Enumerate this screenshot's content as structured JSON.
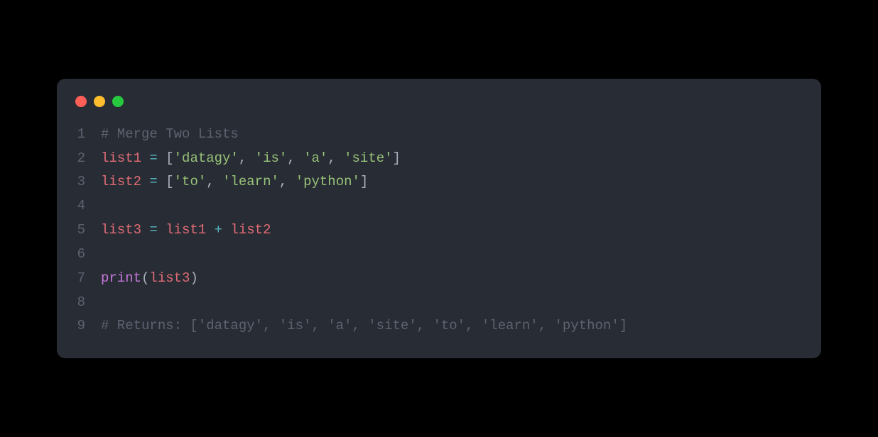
{
  "window": {
    "traffic_lights": [
      "red",
      "yellow",
      "green"
    ]
  },
  "code": {
    "lines": [
      {
        "n": "1",
        "tokens": [
          {
            "t": "# Merge Two Lists",
            "c": "c-comment"
          }
        ]
      },
      {
        "n": "2",
        "tokens": [
          {
            "t": "list1",
            "c": "c-var"
          },
          {
            "t": " ",
            "c": "c-plain"
          },
          {
            "t": "=",
            "c": "c-op"
          },
          {
            "t": " ",
            "c": "c-plain"
          },
          {
            "t": "[",
            "c": "c-punc"
          },
          {
            "t": "'datagy'",
            "c": "c-str"
          },
          {
            "t": ", ",
            "c": "c-punc"
          },
          {
            "t": "'is'",
            "c": "c-str"
          },
          {
            "t": ", ",
            "c": "c-punc"
          },
          {
            "t": "'a'",
            "c": "c-str"
          },
          {
            "t": ", ",
            "c": "c-punc"
          },
          {
            "t": "'site'",
            "c": "c-str"
          },
          {
            "t": "]",
            "c": "c-punc"
          }
        ]
      },
      {
        "n": "3",
        "tokens": [
          {
            "t": "list2",
            "c": "c-var"
          },
          {
            "t": " ",
            "c": "c-plain"
          },
          {
            "t": "=",
            "c": "c-op"
          },
          {
            "t": " ",
            "c": "c-plain"
          },
          {
            "t": "[",
            "c": "c-punc"
          },
          {
            "t": "'to'",
            "c": "c-str"
          },
          {
            "t": ", ",
            "c": "c-punc"
          },
          {
            "t": "'learn'",
            "c": "c-str"
          },
          {
            "t": ", ",
            "c": "c-punc"
          },
          {
            "t": "'python'",
            "c": "c-str"
          },
          {
            "t": "]",
            "c": "c-punc"
          }
        ]
      },
      {
        "n": "4",
        "tokens": [
          {
            "t": "",
            "c": "c-plain"
          }
        ]
      },
      {
        "n": "5",
        "tokens": [
          {
            "t": "list3",
            "c": "c-var"
          },
          {
            "t": " ",
            "c": "c-plain"
          },
          {
            "t": "=",
            "c": "c-op"
          },
          {
            "t": " ",
            "c": "c-plain"
          },
          {
            "t": "list1",
            "c": "c-var"
          },
          {
            "t": " ",
            "c": "c-plain"
          },
          {
            "t": "+",
            "c": "c-op"
          },
          {
            "t": " ",
            "c": "c-plain"
          },
          {
            "t": "list2",
            "c": "c-var"
          }
        ]
      },
      {
        "n": "6",
        "tokens": [
          {
            "t": "",
            "c": "c-plain"
          }
        ]
      },
      {
        "n": "7",
        "tokens": [
          {
            "t": "print",
            "c": "c-func"
          },
          {
            "t": "(",
            "c": "c-punc"
          },
          {
            "t": "list3",
            "c": "c-var"
          },
          {
            "t": ")",
            "c": "c-punc"
          }
        ]
      },
      {
        "n": "8",
        "tokens": [
          {
            "t": "",
            "c": "c-plain"
          }
        ]
      },
      {
        "n": "9",
        "tokens": [
          {
            "t": "# Returns: ['datagy', 'is', 'a', 'site', 'to', 'learn', 'python']",
            "c": "c-comment"
          }
        ]
      }
    ]
  }
}
